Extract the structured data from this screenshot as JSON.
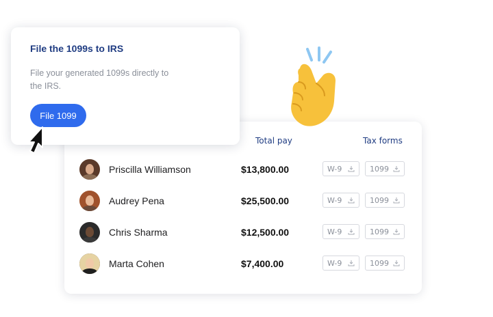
{
  "file_card": {
    "title": "File the 1099s to IRS",
    "description": "File your generated 1099s directly to the IRS.",
    "button_label": "File 1099"
  },
  "table": {
    "headers": {
      "total_pay": "Total pay",
      "tax_forms": "Tax forms"
    },
    "rows": [
      {
        "name": "Priscilla Williamson",
        "pay": "$13,800.00",
        "form_w9": "W-9",
        "form_1099": "1099"
      },
      {
        "name": "Audrey Pena",
        "pay": "$25,500.00",
        "form_w9": "W-9",
        "form_1099": "1099"
      },
      {
        "name": "Chris Sharma",
        "pay": "$12,500.00",
        "form_w9": "W-9",
        "form_1099": "1099"
      },
      {
        "name": "Marta Cohen",
        "pay": "$7,400.00",
        "form_w9": "W-9",
        "form_1099": "1099"
      }
    ]
  },
  "icons": {
    "cursor": "mouse-pointer-icon",
    "snap": "snapping-fingers-emoji",
    "download": "download-icon"
  },
  "colors": {
    "primary": "#2f6bed",
    "heading": "#1f3c82",
    "muted": "#8a8f99",
    "emoji": "#f7c13b"
  }
}
